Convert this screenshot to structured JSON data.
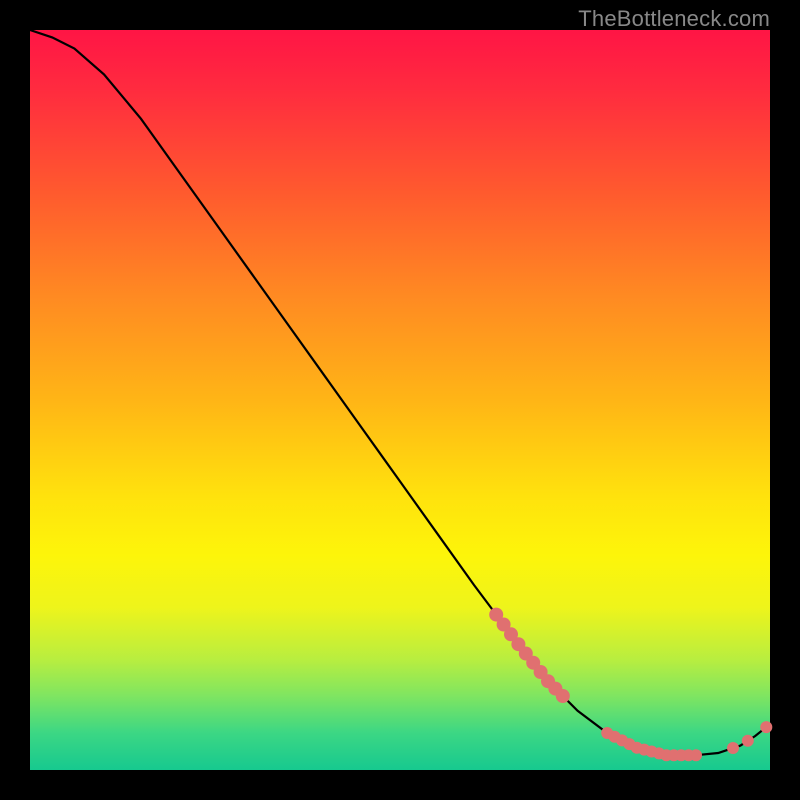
{
  "attribution": "TheBottleneck.com",
  "chart_data": {
    "type": "line",
    "title": "",
    "xlabel": "",
    "ylabel": "",
    "xlim": [
      0,
      100
    ],
    "ylim": [
      0,
      100
    ],
    "grid": false,
    "series": [
      {
        "name": "curve",
        "x": [
          0,
          3,
          6,
          10,
          15,
          20,
          25,
          30,
          35,
          40,
          45,
          50,
          55,
          60,
          63,
          66,
          70,
          74,
          78,
          82,
          86,
          90,
          93,
          96,
          98,
          100
        ],
        "y": [
          100,
          99,
          97.5,
          94,
          88,
          81,
          74,
          67,
          60,
          53,
          46,
          39,
          32,
          25,
          21,
          17,
          12,
          8,
          5,
          3,
          2,
          2,
          2.3,
          3.3,
          4.6,
          6.2
        ]
      }
    ],
    "markers": [
      {
        "name": "cluster-upper",
        "points_x": [
          63,
          64,
          65,
          66,
          67,
          68,
          69,
          70,
          71,
          72
        ],
        "r": 7
      },
      {
        "name": "cluster-lower",
        "points_x": [
          78,
          79,
          80,
          81,
          82,
          83,
          84,
          85,
          86,
          87,
          88,
          89,
          90
        ],
        "r": 6
      },
      {
        "name": "tail-points",
        "points_x": [
          95,
          97,
          99.5
        ],
        "r": 6
      }
    ],
    "colors": {
      "curve": "#000000",
      "marker": "#e07070",
      "gradient_top": "#ff1545",
      "gradient_bottom": "#17c98f"
    }
  }
}
